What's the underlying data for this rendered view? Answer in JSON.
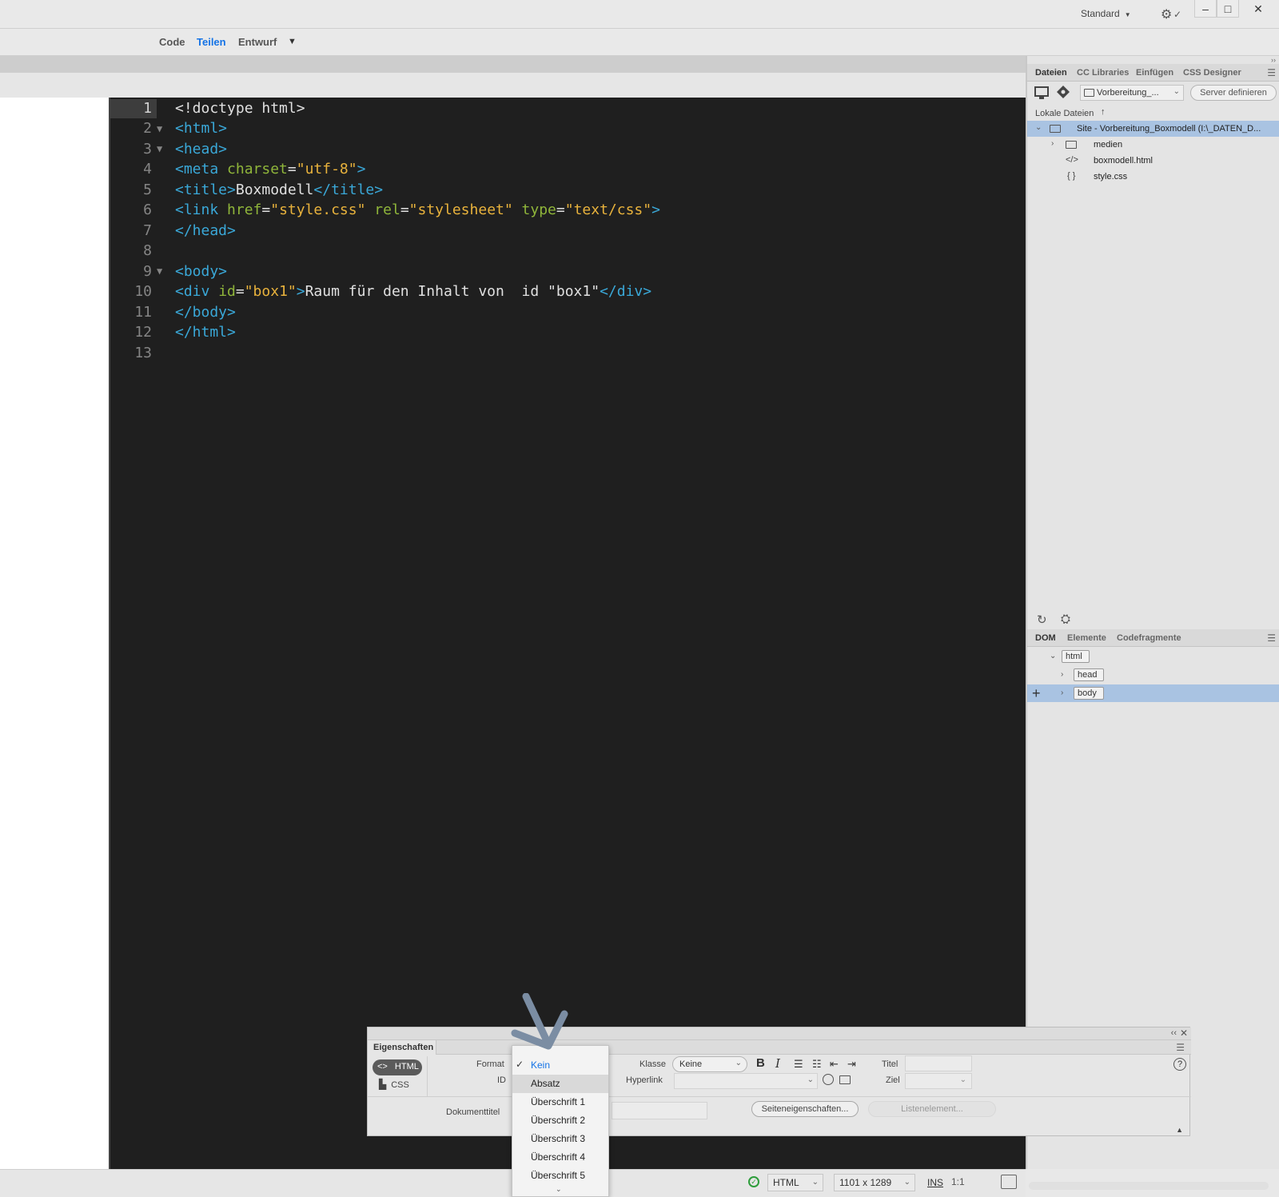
{
  "topbar": {
    "workspace": "Standard"
  },
  "views": {
    "code": "Code",
    "split": "Teilen",
    "design": "Entwurf"
  },
  "editor": {
    "line_numbers": [
      "1",
      "2",
      "3",
      "4",
      "5",
      "6",
      "7",
      "8",
      "9",
      "10",
      "11",
      "12",
      "13"
    ],
    "active_line": 1
  },
  "files_panel": {
    "tabs": [
      "Dateien",
      "CC Libraries",
      "Einfügen",
      "CSS Designer"
    ],
    "site_select": "Vorbereitung_...",
    "server_button": "Server definieren",
    "local_label": "Lokale Dateien",
    "site_root": "Site - Vorbereitung_Boxmodell (I:\\_DATEN_D...",
    "items": [
      {
        "name": "medien",
        "icon": "folder-icon"
      },
      {
        "name": "boxmodell.html",
        "icon": "code-file-icon"
      },
      {
        "name": "style.css",
        "icon": "css-file-icon"
      }
    ]
  },
  "dom_panel": {
    "tabs": [
      "DOM",
      "Elemente",
      "Codefragmente"
    ],
    "nodes": [
      "html",
      "head",
      "body"
    ]
  },
  "statusbar": {
    "language": "HTML",
    "size": "1101 x 1289",
    "ins": "INS",
    "ratio": "1:1"
  },
  "properties": {
    "title": "Eigenschaften",
    "html_button": "HTML",
    "css_button": "CSS",
    "format_label": "Format",
    "id_label": "ID",
    "doctitle_label": "Dokumenttitel",
    "klasse_label": "Klasse",
    "klasse_value": "Keine",
    "hyperlink_label": "Hyperlink",
    "titel_label": "Titel",
    "ziel_label": "Ziel",
    "pageprops_button": "Seiteneigenschaften...",
    "listitem_button": "Listenelement...",
    "bold_glyph": "B",
    "italic_glyph": "I"
  },
  "format_menu": {
    "items": [
      "Kein",
      "Absatz",
      "Überschrift 1",
      "Überschrift 2",
      "Überschrift 3",
      "Überschrift 4",
      "Überschrift 5"
    ],
    "checked": "Kein",
    "hovered": "Absatz"
  },
  "colors": {
    "accent": "#1473e6",
    "editor_bg": "#1f1f1f",
    "tag": "#3aa8d8",
    "attr": "#8fb53a",
    "value": "#e8b23c",
    "selection": "#a9c3e2"
  }
}
